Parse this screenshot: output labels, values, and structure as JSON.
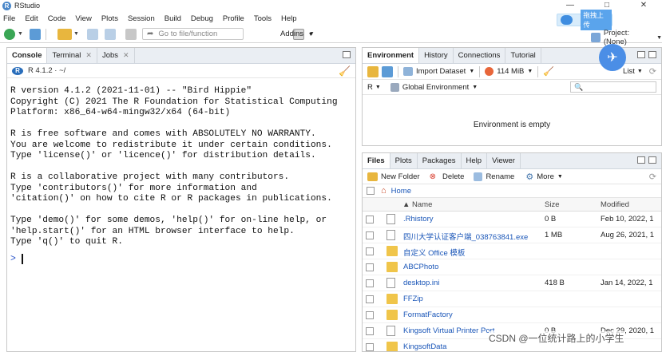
{
  "window": {
    "title": "RStudio",
    "controls": [
      "—",
      "□",
      "✕"
    ]
  },
  "menu": [
    "File",
    "Edit",
    "Code",
    "View",
    "Plots",
    "Session",
    "Build",
    "Debug",
    "Profile",
    "Tools",
    "Help"
  ],
  "overlay": {
    "upload_label": "拖拽上传"
  },
  "toolbar": {
    "goto_placeholder": "Go to file/function",
    "addins_label": "Addins",
    "project_label": "Project: (None)"
  },
  "console": {
    "tabs": [
      {
        "label": "Console"
      },
      {
        "label": "Terminal"
      },
      {
        "label": "Jobs"
      }
    ],
    "r_version_label": "R 4.1.2 · ~/",
    "startup_text": "R version 4.1.2 (2021-11-01) -- \"Bird Hippie\"\nCopyright (C) 2021 The R Foundation for Statistical Computing\nPlatform: x86_64-w64-mingw32/x64 (64-bit)\n\nR is free software and comes with ABSOLUTELY NO WARRANTY.\nYou are welcome to redistribute it under certain conditions.\nType 'license()' or 'licence()' for distribution details.\n\nR is a collaborative project with many contributors.\nType 'contributors()' for more information and\n'citation()' on how to cite R or R packages in publications.\n\nType 'demo()' for some demos, 'help()' for on-line help, or\n'help.start()' for an HTML browser interface to help.\nType 'q()' to quit R.",
    "prompt": ">"
  },
  "environment": {
    "tabs": [
      "Environment",
      "History",
      "Connections",
      "Tutorial"
    ],
    "import_label": "Import Dataset",
    "memory_label": "114 MiB",
    "list_label": "List",
    "r_label": "R",
    "scope_label": "Global Environment",
    "empty_message": "Environment is empty"
  },
  "files": {
    "tabs": [
      "Files",
      "Plots",
      "Packages",
      "Help",
      "Viewer"
    ],
    "new_folder_label": "New Folder",
    "delete_label": "Delete",
    "rename_label": "Rename",
    "more_label": "More",
    "home_label": "Home",
    "columns": {
      "name": "▲ Name",
      "size": "Size",
      "modified": "Modified"
    },
    "rows": [
      {
        "name": ".Rhistory",
        "size": "0 B",
        "modified": "Feb 10, 2022, 1",
        "icon": "doc"
      },
      {
        "name": "四川大学认证客户端_038763841.exe",
        "size": "1 MB",
        "modified": "Aug 26, 2021, 1",
        "icon": "doc"
      },
      {
        "name": "自定义 Office 模板",
        "size": "",
        "modified": "",
        "icon": "folder"
      },
      {
        "name": "ABCPhoto",
        "size": "",
        "modified": "",
        "icon": "folder"
      },
      {
        "name": "desktop.ini",
        "size": "418 B",
        "modified": "Jan 14, 2022, 1",
        "icon": "doc"
      },
      {
        "name": "FFZip",
        "size": "",
        "modified": "",
        "icon": "folder"
      },
      {
        "name": "FormatFactory",
        "size": "",
        "modified": "",
        "icon": "folder"
      },
      {
        "name": "Kingsoft Virtual Printer Port",
        "size": "0 B",
        "modified": "Dec 29, 2020, 1",
        "icon": "doc"
      },
      {
        "name": "KingsoftData",
        "size": "",
        "modified": "",
        "icon": "folder"
      }
    ]
  },
  "watermark": "CSDN @一位统计路上的小学生"
}
